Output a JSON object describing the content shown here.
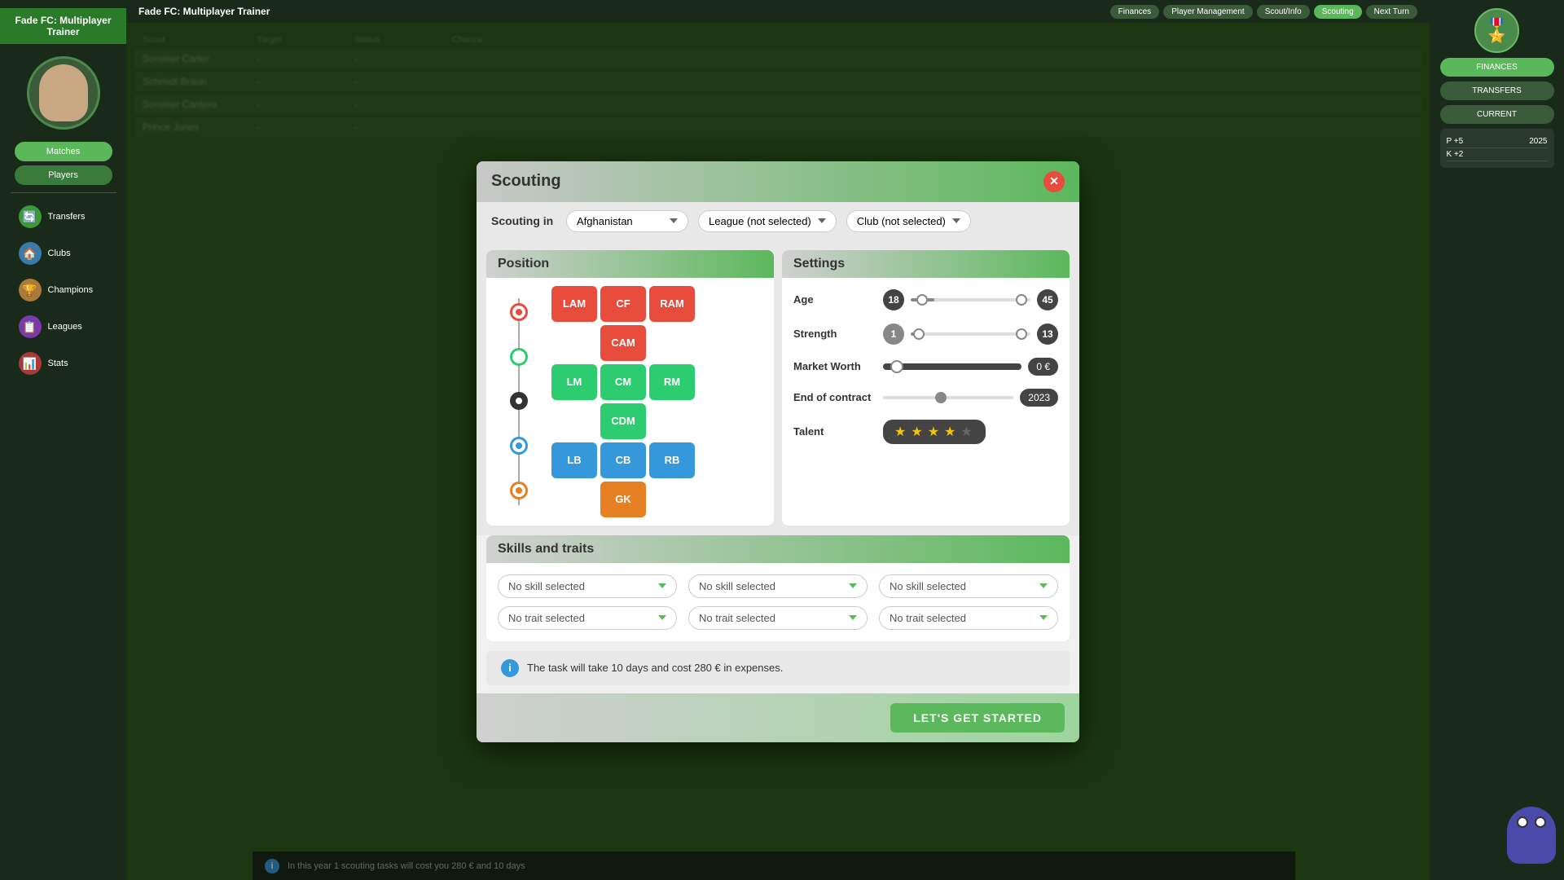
{
  "app": {
    "title": "Fade FC: Multiplayer Trainer"
  },
  "topbar": {
    "nav_items": [
      "Finances",
      "Player Management",
      "Scout/Info",
      "Scouting",
      "Next Turn"
    ]
  },
  "modal": {
    "title": "Scouting",
    "scouting_in_label": "Scouting in",
    "country": "Afghanistan",
    "league": "League (not selected)",
    "club": "Club (not selected)",
    "position_section": {
      "header": "Position",
      "positions": {
        "row1": [
          "LAM",
          "CF",
          "RAM"
        ],
        "row2": [
          "",
          "CAM",
          ""
        ],
        "row3": [
          "LM",
          "CM",
          "RM"
        ],
        "row4": [
          "",
          "CDM",
          ""
        ],
        "row5": [
          "LB",
          "CB",
          "RB"
        ],
        "row6": [
          "",
          "GK",
          ""
        ]
      },
      "colors": {
        "LAM": "red",
        "CF": "red",
        "RAM": "red",
        "CAM": "red",
        "LM": "green",
        "CM": "green",
        "RM": "green",
        "CDM": "green",
        "LB": "blue",
        "CB": "blue",
        "RB": "blue",
        "GK": "orange"
      }
    },
    "settings_section": {
      "header": "Settings",
      "age_label": "Age",
      "age_min": "18",
      "age_max": "45",
      "strength_label": "Strength",
      "strength_min": "1",
      "strength_max": "13",
      "market_worth_label": "Market Worth",
      "market_worth_val": "0 €",
      "contract_label": "End of contract",
      "contract_val": "2023",
      "talent_label": "Talent",
      "talent_stars": "★★★★"
    },
    "skills_section": {
      "header": "Skills and traits",
      "skill1": "No skill selected",
      "skill2": "No skill selected",
      "skill3": "No skill selected",
      "trait1": "No trait selected",
      "trait2": "No trait selected",
      "trait3": "No trait selected"
    },
    "info_text": "The task will take 10 days and cost 280 € in expenses.",
    "start_button": "LET'S GET STARTED"
  },
  "sidebar": {
    "nav_items": [
      {
        "label": "Matches",
        "color": "#5ab85a"
      },
      {
        "label": "Players",
        "color": "#3a7a3a"
      },
      {
        "label": "Transfers",
        "color": "#3a7a3a"
      },
      {
        "label": "Clubs",
        "color": "#3a7a3a"
      },
      {
        "label": "Champions",
        "color": "#3a7a3a"
      },
      {
        "label": "Leagues",
        "color": "#3a7a3a"
      },
      {
        "label": "Stats",
        "color": "#3a7a3a"
      }
    ]
  },
  "right_sidebar": {
    "stats": [
      {
        "label": "P+5, K+2",
        "val": "2025"
      },
      {
        "label": "FINANCES",
        "val": ""
      },
      {
        "label": "TRANSFERS",
        "val": ""
      },
      {
        "label": "CURRENT",
        "val": ""
      }
    ]
  },
  "background": {
    "table_headers": [
      "Scout",
      "Target",
      "Status",
      "Chance"
    ],
    "table_rows": [
      {
        "scout": "Sommer Carter",
        "target": "-",
        "status": "-",
        "chance": ""
      },
      {
        "scout": "Schmidt Braun",
        "target": "-",
        "status": "-",
        "chance": ""
      },
      {
        "scout": "Sommer Cantero",
        "target": "-",
        "status": "-",
        "chance": ""
      },
      {
        "scout": "Prince Jones",
        "target": "-",
        "status": "-",
        "chance": ""
      }
    ]
  },
  "bottom_bar": {
    "info_text": "In this year 1 scouting tasks will cost you 280 € and 10 days"
  }
}
